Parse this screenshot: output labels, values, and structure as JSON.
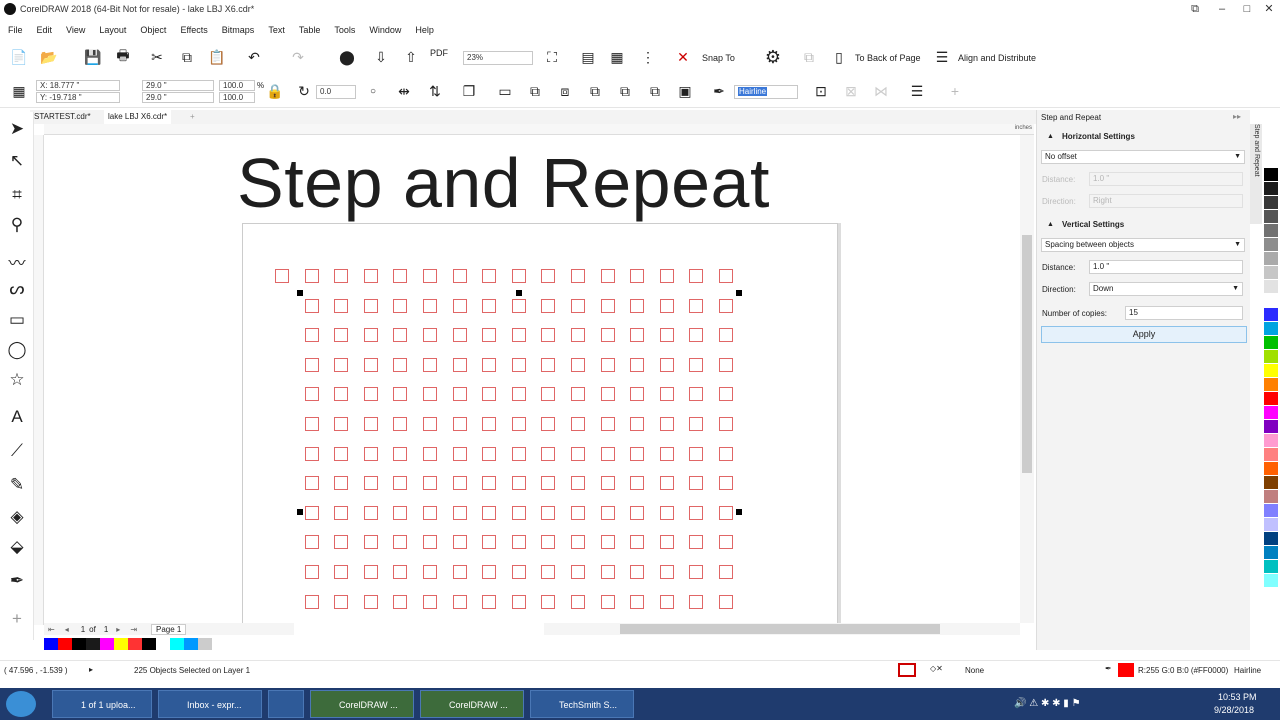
{
  "window": {
    "title": "CorelDRAW 2018 (64-Bit Not for resale) - lake LBJ X6.cdr*"
  },
  "menu": [
    "File",
    "Edit",
    "View",
    "Layout",
    "Object",
    "Effects",
    "Bitmaps",
    "Text",
    "Table",
    "Tools",
    "Window",
    "Help"
  ],
  "toolbar": {
    "zoom": "23%",
    "snap_to": "Snap To",
    "to_back_of_page": "To Back of Page",
    "align_distribute": "Align and Distribute",
    "pdf_label": "PDF"
  },
  "propbar": {
    "x": "X: 18.777 \"",
    "y": "Y: -19.718 \"",
    "width": "29.0 \"",
    "height": "29.0 \"",
    "scale_w": "100.0",
    "scale_h": "100.0",
    "pct": "%",
    "angle": "0.0",
    "outline": "Hairline"
  },
  "tabs": [
    "STARTEST.cdr*",
    "lake LBJ X6.cdr*"
  ],
  "ruler_unit": "inches",
  "canvas": {
    "title": "Step and Repeat"
  },
  "pagenav": {
    "current": "1",
    "of": "of",
    "total": "1",
    "page_tab": "Page 1"
  },
  "docker": {
    "title": "Step and Repeat",
    "horizontal": {
      "heading": "Horizontal Settings",
      "mode": "No offset",
      "distance_label": "Distance:",
      "distance": "1.0 \"",
      "direction_label": "Direction:",
      "direction": "Right"
    },
    "vertical": {
      "heading": "Vertical Settings",
      "mode": "Spacing between objects",
      "distance_label": "Distance:",
      "distance": "1.0 \"",
      "direction_label": "Direction:",
      "direction": "Down"
    },
    "copies_label": "Number of copies:",
    "copies": "15",
    "apply": "Apply"
  },
  "status": {
    "coords": "( 47.596 , -1.539 )",
    "selection": "225 Objects Selected on Layer 1",
    "fill": "None",
    "color_info": "R:255 G:0 B:0 (#FF0000)",
    "outline": "Hairline"
  },
  "taskbar": {
    "items": [
      "1 of 1 uploa...",
      "Inbox - expr...",
      "CorelDRAW ...",
      "CorelDRAW ...",
      "TechSmith S..."
    ],
    "time": "10:53 PM",
    "date": "9/28/2018"
  },
  "colors": {
    "accent": "#1b5fb4",
    "shape_outline": "#e06666",
    "selected_fill": "#ff0000"
  },
  "palette": [
    "#000000",
    "#1c1c1c",
    "#383838",
    "#555555",
    "#717171",
    "#8d8d8d",
    "#aaaaaa",
    "#c6c6c6",
    "#e2e2e2",
    "#ffffff",
    "#2b2bff",
    "#00a3e0",
    "#00c000",
    "#a0e000",
    "#ffff00",
    "#ff8000",
    "#ff0000",
    "#ff00ff",
    "#8000c0",
    "#ff9bd0",
    "#ff8080",
    "#ff6000",
    "#7f3f00",
    "#c07f7f",
    "#8080ff",
    "#c0c0ff",
    "#004080",
    "#0080c0",
    "#00c0c0",
    "#80ffff"
  ],
  "bottom_palette": [
    "#0000ff",
    "#ff0000",
    "#000000",
    "#1a1a1a",
    "#ff00ff",
    "#ffff00",
    "#ff3333",
    "#000000",
    "#ffffff",
    "#00ffff",
    "#0099ff",
    "#cccccc"
  ]
}
